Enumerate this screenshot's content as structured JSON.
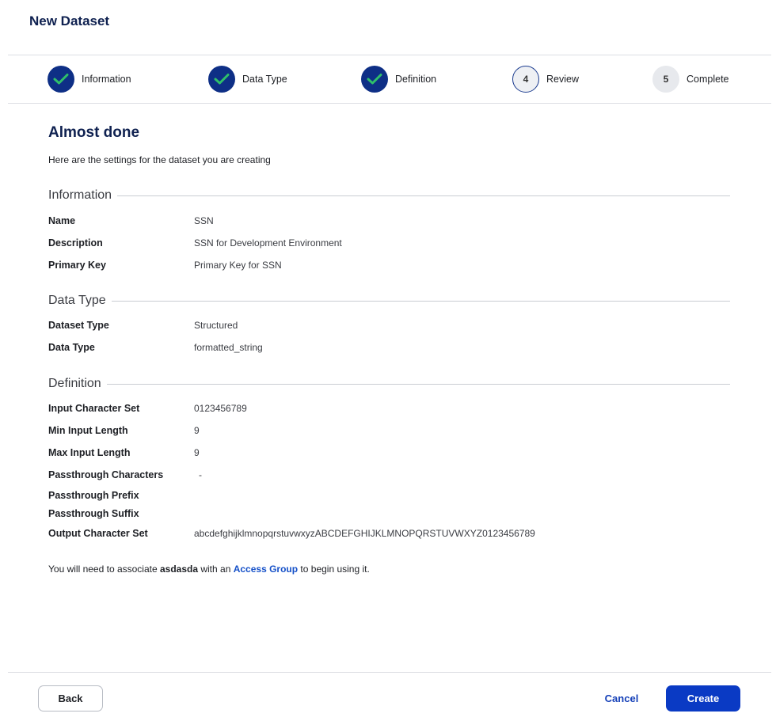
{
  "page": {
    "title": "New Dataset"
  },
  "stepper": {
    "steps": [
      {
        "label": "Information",
        "status": "done"
      },
      {
        "label": "Data Type",
        "status": "done"
      },
      {
        "label": "Definition",
        "status": "done"
      },
      {
        "label": "Review",
        "number": "4",
        "status": "current"
      },
      {
        "label": "Complete",
        "number": "5",
        "status": "todo"
      }
    ]
  },
  "main": {
    "heading": "Almost done",
    "subtext": "Here are the settings for the dataset you are creating"
  },
  "information": {
    "title": "Information",
    "fields": [
      {
        "label": "Name",
        "value": "SSN"
      },
      {
        "label": "Description",
        "value": "SSN for Development Environment"
      },
      {
        "label": "Primary Key",
        "value": "Primary Key for SSN"
      }
    ]
  },
  "data_type": {
    "title": "Data Type",
    "fields": [
      {
        "label": "Dataset Type",
        "value": "Structured"
      },
      {
        "label": "Data Type",
        "value": "formatted_string"
      }
    ]
  },
  "definition": {
    "title": "Definition",
    "fields": [
      {
        "label": "Input Character Set",
        "value": "0123456789"
      },
      {
        "label": "Min Input Length",
        "value": "9"
      },
      {
        "label": "Max Input Length",
        "value": "9"
      },
      {
        "label": "Passthrough Characters",
        "value": "-"
      },
      {
        "label": "Passthrough Prefix",
        "value": ""
      },
      {
        "label": "Passthrough Suffix",
        "value": ""
      },
      {
        "label": "Output Character Set",
        "value": "abcdefghijklmnopqrstuvwxyzABCDEFGHIJKLMNOPQRSTUVWXYZ0123456789"
      }
    ]
  },
  "note": {
    "prefix": "You will need to associate ",
    "dataset_name": "asdasda",
    "middle": " with an ",
    "link": "Access Group",
    "suffix": " to begin using it."
  },
  "footer": {
    "back_label": "Back",
    "cancel_label": "Cancel",
    "create_label": "Create"
  },
  "colors": {
    "primary": "#0a3ac4",
    "step_done": "#0e2f86",
    "check": "#2fc06a",
    "heading": "#0f2150"
  }
}
